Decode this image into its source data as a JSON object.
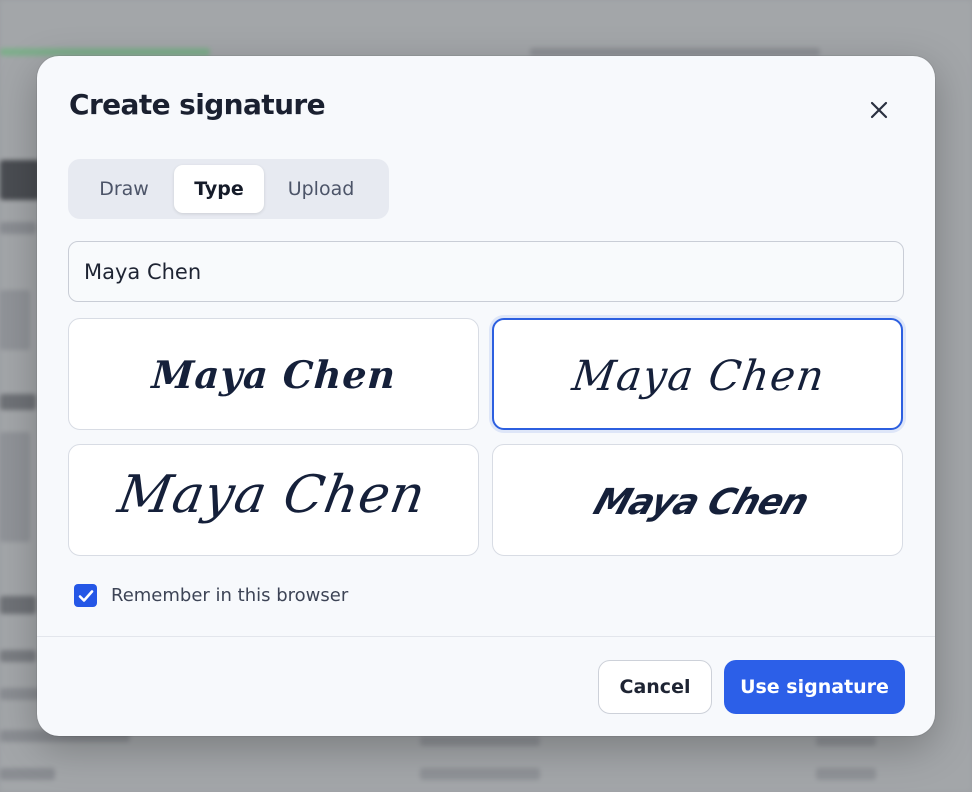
{
  "dialog": {
    "title": "Create signature",
    "close_icon": "close-icon"
  },
  "tabs": [
    {
      "label": "Draw",
      "active": false
    },
    {
      "label": "Type",
      "active": true
    },
    {
      "label": "Upload",
      "active": false
    }
  ],
  "name_input": {
    "value": "Maya Chen"
  },
  "signature_options": [
    {
      "text": "Maya Chen",
      "style": "upright-brush",
      "selected": false
    },
    {
      "text": "Maya Chen",
      "style": "slanted-script",
      "selected": true
    },
    {
      "text": "Maya Chen",
      "style": "large-handwritten",
      "selected": false
    },
    {
      "text": "Maya Chen",
      "style": "bold-italic-script",
      "selected": false
    }
  ],
  "remember": {
    "label": "Remember in this browser",
    "checked": true
  },
  "actions": {
    "cancel_label": "Cancel",
    "primary_label": "Use signature"
  },
  "colors": {
    "accent": "#2c5fe8",
    "ink": "#15203a"
  }
}
